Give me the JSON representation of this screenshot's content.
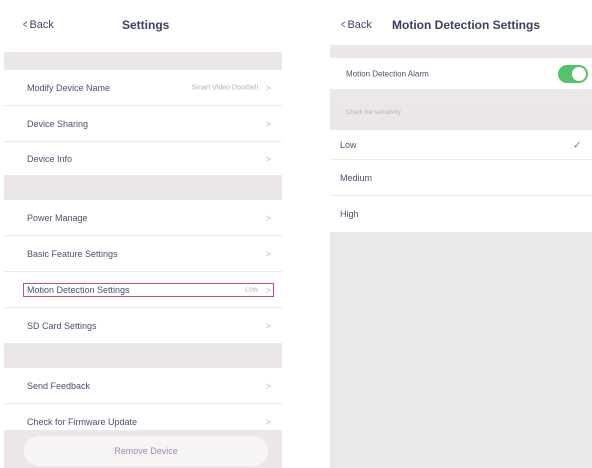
{
  "settings": {
    "back_label": "Back",
    "title": "Settings",
    "items": [
      {
        "label": "Modify Device Name",
        "value": "Smart Video Doorbell"
      },
      {
        "label": "Device Sharing"
      },
      {
        "label": "Device Info"
      },
      {
        "label": "Power Manage"
      },
      {
        "label": "Basic Feature Settings"
      },
      {
        "label": "Motion Detection Settings",
        "value": "Low"
      },
      {
        "label": "SD Card Settings"
      },
      {
        "label": "Send Feedback"
      },
      {
        "label": "Check for Firmware Update"
      }
    ],
    "remove_button": "Remove Device"
  },
  "motion": {
    "back_label": "Back",
    "title": "Motion Detection Settings",
    "alarm_label": "Motion Detection Alarm",
    "alarm_enabled": true,
    "section_header": "Check the sensitivity",
    "options": [
      {
        "label": "Low",
        "selected": true
      },
      {
        "label": "Medium",
        "selected": false
      },
      {
        "label": "High",
        "selected": false
      }
    ]
  },
  "colors": {
    "toggle_on": "#58c16d",
    "separator": "#ebe6e8",
    "highlight_border": "#c0506a"
  },
  "icons": {
    "back": "chevron-left-icon",
    "row": "chevron-right-icon",
    "selected": "checkmark-icon"
  }
}
